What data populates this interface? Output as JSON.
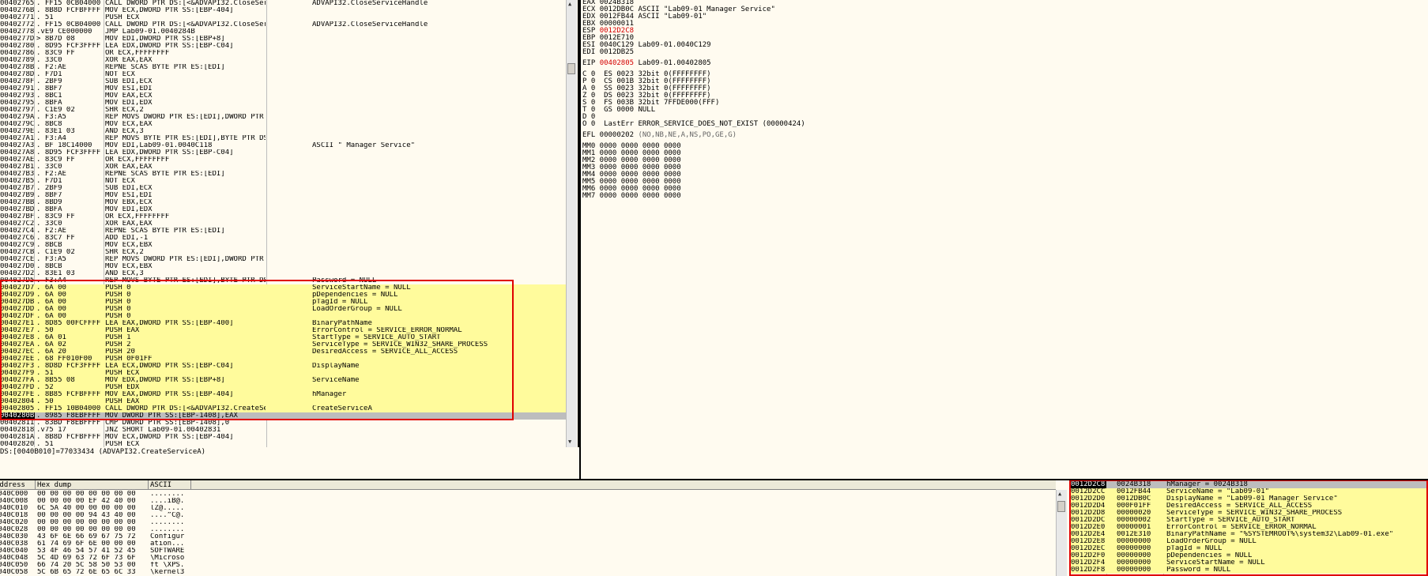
{
  "disasm": [
    {
      "addr": "00402765",
      "hex": ". FF15 0CB04000",
      "asm": "CALL DWORD PTR DS:[<&ADVAPI32.CloseServ",
      "cmt": "ADVAPI32.CloseServiceHandle"
    },
    {
      "addr": "0040276B",
      "hex": ". 8B8D FCFBFFFF",
      "asm": "MOV ECX,DWORD PTR SS:[EBP-404]",
      "cmt": ""
    },
    {
      "addr": "00402771",
      "hex": ". 51",
      "asm": "PUSH ECX",
      "cmt": ""
    },
    {
      "addr": "00402772",
      "hex": ". FF15 0CB04000",
      "asm": "CALL DWORD PTR DS:[<&ADVAPI32.CloseServ",
      "cmt": "ADVAPI32.CloseServiceHandle"
    },
    {
      "addr": "00402778",
      "hex": ".vE9 CE000000",
      "asm": "JMP Lab09-01.0040284B",
      "cmt": ""
    },
    {
      "addr": "0040277D",
      "hex": "> 8B7D 08",
      "asm": "MOV EDI,DWORD PTR SS:[EBP+8]",
      "cmt": ""
    },
    {
      "addr": "00402780",
      "hex": ". 8D95 FCF3FFFF",
      "asm": "LEA EDX,DWORD PTR SS:[EBP-C04]",
      "cmt": ""
    },
    {
      "addr": "00402786",
      "hex": ". 83C9 FF",
      "asm": "OR ECX,FFFFFFFF",
      "cmt": ""
    },
    {
      "addr": "00402789",
      "hex": ". 33C0",
      "asm": "XOR EAX,EAX",
      "cmt": ""
    },
    {
      "addr": "0040278B",
      "hex": ". F2:AE",
      "asm": "REPNE SCAS BYTE PTR ES:[EDI]",
      "cmt": ""
    },
    {
      "addr": "0040278D",
      "hex": ". F7D1",
      "asm": "NOT ECX",
      "cmt": ""
    },
    {
      "addr": "0040278F",
      "hex": ". 2BF9",
      "asm": "SUB EDI,ECX",
      "cmt": ""
    },
    {
      "addr": "00402791",
      "hex": ". 8BF7",
      "asm": "MOV ESI,EDI",
      "cmt": ""
    },
    {
      "addr": "00402793",
      "hex": ". 8BC1",
      "asm": "MOV EAX,ECX",
      "cmt": ""
    },
    {
      "addr": "00402795",
      "hex": ". 8BFA",
      "asm": "MOV EDI,EDX",
      "cmt": ""
    },
    {
      "addr": "00402797",
      "hex": ". C1E9 02",
      "asm": "SHR ECX,2",
      "cmt": ""
    },
    {
      "addr": "0040279A",
      "hex": ". F3:A5",
      "asm": "REP MOVS DWORD PTR ES:[EDI],DWORD PTR DS:",
      "cmt": ""
    },
    {
      "addr": "0040279C",
      "hex": ". 8BC8",
      "asm": "MOV ECX,EAX",
      "cmt": ""
    },
    {
      "addr": "0040279E",
      "hex": ". 83E1 03",
      "asm": "AND ECX,3",
      "cmt": ""
    },
    {
      "addr": "004027A1",
      "hex": ". F3:A4",
      "asm": "REP MOVS BYTE PTR ES:[EDI],BYTE PTR DS:",
      "cmt": ""
    },
    {
      "addr": "004027A3",
      "hex": ". BF 18C14000",
      "asm": "MOV EDI,Lab09-01.0040C118",
      "cmt": "ASCII \" Manager Service\""
    },
    {
      "addr": "004027A8",
      "hex": ". 8D95 FCF3FFFF",
      "asm": "LEA EDX,DWORD PTR SS:[EBP-C04]",
      "cmt": ""
    },
    {
      "addr": "004027AE",
      "hex": ". 83C9 FF",
      "asm": "OR ECX,FFFFFFFF",
      "cmt": ""
    },
    {
      "addr": "004027B1",
      "hex": ". 33C0",
      "asm": "XOR EAX,EAX",
      "cmt": ""
    },
    {
      "addr": "004027B3",
      "hex": ". F2:AE",
      "asm": "REPNE SCAS BYTE PTR ES:[EDI]",
      "cmt": ""
    },
    {
      "addr": "004027B5",
      "hex": ". F7D1",
      "asm": "NOT ECX",
      "cmt": ""
    },
    {
      "addr": "004027B7",
      "hex": ". 2BF9",
      "asm": "SUB EDI,ECX",
      "cmt": ""
    },
    {
      "addr": "004027B9",
      "hex": ". 8BF7",
      "asm": "MOV ESI,EDI",
      "cmt": ""
    },
    {
      "addr": "004027BB",
      "hex": ". 8BD9",
      "asm": "MOV EBX,ECX",
      "cmt": ""
    },
    {
      "addr": "004027BD",
      "hex": ". 8BFA",
      "asm": "MOV EDI,EDX",
      "cmt": ""
    },
    {
      "addr": "004027BF",
      "hex": ". 83C9 FF",
      "asm": "OR ECX,FFFFFFFF",
      "cmt": ""
    },
    {
      "addr": "004027C2",
      "hex": ". 33C0",
      "asm": "XOR EAX,EAX",
      "cmt": ""
    },
    {
      "addr": "004027C4",
      "hex": ". F2:AE",
      "asm": "REPNE SCAS BYTE PTR ES:[EDI]",
      "cmt": ""
    },
    {
      "addr": "004027C6",
      "hex": ". 83C7 FF",
      "asm": "ADD EDI,-1",
      "cmt": ""
    },
    {
      "addr": "004027C9",
      "hex": ". 8BCB",
      "asm": "MOV ECX,EBX",
      "cmt": ""
    },
    {
      "addr": "004027CB",
      "hex": ". C1E9 02",
      "asm": "SHR ECX,2",
      "cmt": ""
    },
    {
      "addr": "004027CE",
      "hex": ". F3:A5",
      "asm": "REP MOVS DWORD PTR ES:[EDI],DWORD PTR DS:",
      "cmt": ""
    },
    {
      "addr": "004027D0",
      "hex": ". 8BCB",
      "asm": "MOV ECX,EBX",
      "cmt": ""
    },
    {
      "addr": "004027D2",
      "hex": ". 83E1 03",
      "asm": "AND ECX,3",
      "cmt": ""
    },
    {
      "addr": "004027D5",
      "hex": ". F3:A4",
      "asm": "REP MOVS BYTE PTR ES:[EDI],BYTE PTR DS:",
      "cmt": "Password = NULL"
    },
    {
      "addr": "004027D7",
      "hex": ". 6A 00",
      "asm": "PUSH 0",
      "cmt": "ServiceStartName = NULL"
    },
    {
      "addr": "004027D9",
      "hex": ". 6A 00",
      "asm": "PUSH 0",
      "cmt": "pDependencies = NULL"
    },
    {
      "addr": "004027DB",
      "hex": ". 6A 00",
      "asm": "PUSH 0",
      "cmt": "pTagId = NULL"
    },
    {
      "addr": "004027DD",
      "hex": ". 6A 00",
      "asm": "PUSH 0",
      "cmt": "LoadOrderGroup = NULL"
    },
    {
      "addr": "004027DF",
      "hex": ". 6A 00",
      "asm": "PUSH 0",
      "cmt": ""
    },
    {
      "addr": "004027E1",
      "hex": ". 8D85 00FCFFFF",
      "asm": "LEA EAX,DWORD PTR SS:[EBP-400]",
      "cmt": "BinaryPathName"
    },
    {
      "addr": "004027E7",
      "hex": ". 50",
      "asm": "PUSH EAX",
      "cmt": "ErrorControl = SERVICE_ERROR_NORMAL"
    },
    {
      "addr": "004027E8",
      "hex": ". 6A 01",
      "asm": "PUSH 1",
      "cmt": "StartType = SERVICE_AUTO_START"
    },
    {
      "addr": "004027EA",
      "hex": ". 6A 02",
      "asm": "PUSH 2",
      "cmt": "ServiceType = SERVICE_WIN32_SHARE_PROCESS"
    },
    {
      "addr": "004027EC",
      "hex": ". 6A 20",
      "asm": "PUSH 20",
      "cmt": "DesiredAccess = SERVICE_ALL_ACCESS"
    },
    {
      "addr": "004027EE",
      "hex": ". 68 FF010F00",
      "asm": "PUSH 0F01FF",
      "cmt": ""
    },
    {
      "addr": "004027F3",
      "hex": ". 8D8D FCF3FFFF",
      "asm": "LEA ECX,DWORD PTR SS:[EBP-C04]",
      "cmt": "DisplayName"
    },
    {
      "addr": "004027F9",
      "hex": ". 51",
      "asm": "PUSH ECX",
      "cmt": ""
    },
    {
      "addr": "004027FA",
      "hex": ". 8B55 08",
      "asm": "MOV EDX,DWORD PTR SS:[EBP+8]",
      "cmt": "ServiceName"
    },
    {
      "addr": "004027FD",
      "hex": ". 52",
      "asm": "PUSH EDX",
      "cmt": ""
    },
    {
      "addr": "004027FE",
      "hex": ". 8B85 FCFBFFFF",
      "asm": "MOV EAX,DWORD PTR SS:[EBP-404]",
      "cmt": "hManager"
    },
    {
      "addr": "00402804",
      "hex": ". 50",
      "asm": "PUSH EAX",
      "cmt": ""
    },
    {
      "addr": "00402805",
      "hex": ". FF15 10B04000",
      "asm": "CALL DWORD PTR DS:[<&ADVAPI32.CreateServ",
      "cmt": "CreateServiceA"
    },
    {
      "addr": "0040280B",
      "hex": ". 8985 F8EBFFFF",
      "asm": "MOV DWORD PTR SS:[EBP-1408],EAX",
      "cmt": ""
    },
    {
      "addr": "00402811",
      "hex": ". 83BD F8EBFFFF",
      "asm": "CMP DWORD PTR SS:[EBP-1408],0",
      "cmt": ""
    },
    {
      "addr": "00402818",
      "hex": ".v75 17",
      "asm": "JNZ SHORT Lab09-01.00402831",
      "cmt": ""
    },
    {
      "addr": "0040281A",
      "hex": ". 8B8D FCFBFFFF",
      "asm": "MOV ECX,DWORD PTR SS:[EBP-404]",
      "cmt": ""
    },
    {
      "addr": "00402820",
      "hex": ". 51",
      "asm": "PUSH ECX",
      "cmt": ""
    }
  ],
  "info_line": "DS:[0040B010]=77033434 (ADVAPI32.CreateServiceA)",
  "registers": [
    {
      "name": "EAX",
      "val": "0024B318",
      "desc": "",
      "red": false
    },
    {
      "name": "ECX",
      "val": "0012DB0C",
      "desc": "ASCII \"Lab09-01 Manager Service\"",
      "red": false
    },
    {
      "name": "EDX",
      "val": "0012FB44",
      "desc": "ASCII \"Lab09-01\"",
      "red": false
    },
    {
      "name": "EBX",
      "val": "00000011",
      "desc": "",
      "red": false
    },
    {
      "name": "ESP",
      "val": "0012D2C8",
      "desc": "",
      "red": true
    },
    {
      "name": "EBP",
      "val": "0012E710",
      "desc": "",
      "red": false
    },
    {
      "name": "ESI",
      "val": "0040C129",
      "desc": "Lab09-01.0040C129",
      "red": false
    },
    {
      "name": "EDI",
      "val": "0012DB25",
      "desc": "",
      "red": false
    }
  ],
  "eip": {
    "name": "EIP",
    "val": "00402805",
    "desc": "Lab09-01.00402805"
  },
  "flags": [
    "C 0  ES 0023 32bit 0(FFFFFFFF)",
    "P 0  CS 001B 32bit 0(FFFFFFFF)",
    "A 0  SS 0023 32bit 0(FFFFFFFF)",
    "Z 0  DS 0023 32bit 0(FFFFFFFF)",
    "S 0  FS 003B 32bit 7FFDE000(FFF)",
    "T 0  GS 0000 NULL",
    "D 0",
    "O 0  LastErr ERROR_SERVICE_DOES_NOT_EXIST (00000424)"
  ],
  "efl": {
    "label": "EFL 00000202",
    "desc": "(NO,NB,NE,A,NS,PO,GE,G)"
  },
  "mmx": [
    "MM0 0000 0000 0000 0000",
    "MM1 0000 0000 0000 0000",
    "MM2 0000 0000 0000 0000",
    "MM3 0000 0000 0000 0000",
    "MM4 0000 0000 0000 0000",
    "MM5 0000 0000 0000 0000",
    "MM6 0000 0000 0000 0000",
    "MM7 0000 0000 0000 0000"
  ],
  "dump_headers": {
    "address": "Address",
    "hex": "Hex dump",
    "ascii": "ASCII"
  },
  "dump": [
    {
      "addr": "0040C000",
      "hex": "00 00 00 00 00 00 00 00",
      "ascii": "........"
    },
    {
      "addr": "0040C008",
      "hex": "00 00 00 00 EF 42 40 00",
      "ascii": "....ïB@."
    },
    {
      "addr": "0040C010",
      "hex": "6C 5A 40 00 00 00 00 00",
      "ascii": "lZ@....."
    },
    {
      "addr": "0040C018",
      "hex": "00 00 00 00 94 43 40 00",
      "ascii": "....”C@."
    },
    {
      "addr": "0040C020",
      "hex": "00 00 00 00 00 00 00 00",
      "ascii": "........"
    },
    {
      "addr": "0040C028",
      "hex": "00 00 00 00 00 00 00 00",
      "ascii": "........"
    },
    {
      "addr": "0040C030",
      "hex": "43 6F 6E 66 69 67 75 72",
      "ascii": "Configur"
    },
    {
      "addr": "0040C038",
      "hex": "61 74 69 6F 6E 00 00 00",
      "ascii": "ation..."
    },
    {
      "addr": "0040C040",
      "hex": "53 4F 46 54 57 41 52 45",
      "ascii": "SOFTWARE"
    },
    {
      "addr": "0040C048",
      "hex": "5C 4D 69 63 72 6F 73 6F",
      "ascii": "\\Microso"
    },
    {
      "addr": "0040C050",
      "hex": "66 74 20 5C 58 50 53 00",
      "ascii": "ft \\XPS."
    },
    {
      "addr": "0040C058",
      "hex": "5C 6B 65 72 6E 65 6C 33",
      "ascii": "\\kernel3"
    }
  ],
  "stack": [
    {
      "addr": "0012D2C8",
      "val": "0024B318",
      "cmt": "hManager = 0024B318"
    },
    {
      "addr": "0012D2CC",
      "val": "0012FB44",
      "cmt": "ServiceName = \"Lab09-01\""
    },
    {
      "addr": "0012D2D0",
      "val": "0012DB0C",
      "cmt": "DisplayName = \"Lab09-01 Manager Service\""
    },
    {
      "addr": "0012D2D4",
      "val": "000F01FF",
      "cmt": "DesiredAccess = SERVICE_ALL_ACCESS"
    },
    {
      "addr": "0012D2D8",
      "val": "00000020",
      "cmt": "ServiceType = SERVICE_WIN32_SHARE_PROCESS"
    },
    {
      "addr": "0012D2DC",
      "val": "00000002",
      "cmt": "StartType = SERVICE_AUTO_START"
    },
    {
      "addr": "0012D2E0",
      "val": "00000001",
      "cmt": "ErrorControl = SERVICE_ERROR_NORMAL"
    },
    {
      "addr": "0012D2E4",
      "val": "0012E310",
      "cmt": "BinaryPathName = \"%SYSTEMROOT%\\system32\\Lab09-01.exe\""
    },
    {
      "addr": "0012D2E8",
      "val": "00000000",
      "cmt": "LoadOrderGroup = NULL"
    },
    {
      "addr": "0012D2EC",
      "val": "00000000",
      "cmt": "pTagId = NULL"
    },
    {
      "addr": "0012D2F0",
      "val": "00000000",
      "cmt": "pDependencies = NULL"
    },
    {
      "addr": "0012D2F4",
      "val": "00000000",
      "cmt": "ServiceStartName = NULL"
    },
    {
      "addr": "0012D2F8",
      "val": "00000000",
      "cmt": "Password = NULL"
    }
  ],
  "colors": {
    "highlight": "#fffb9c",
    "redbox": "#e00000",
    "accent_red": "#d40000"
  },
  "icons": {
    "scroll_up": "▲",
    "scroll_down": "▼"
  }
}
